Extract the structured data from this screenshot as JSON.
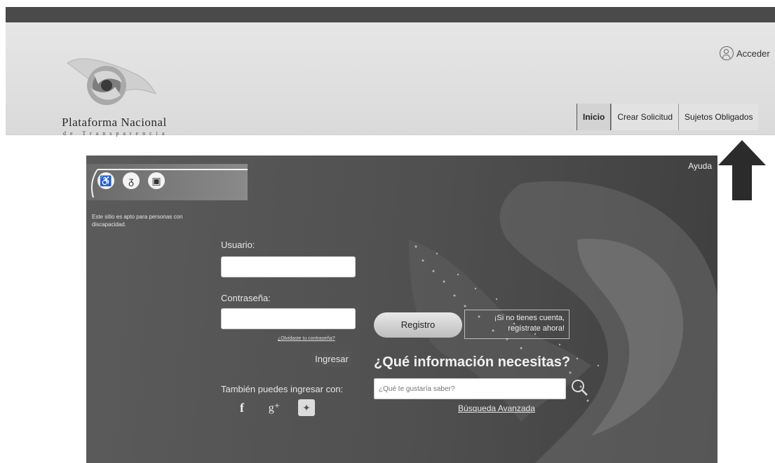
{
  "header": {
    "brand_title": "Plataforma Nacional",
    "brand_subtitle": "de Transparencia",
    "acceder": "Acceder",
    "nav": [
      {
        "label": "Inicio",
        "active": true
      },
      {
        "label": "Crear Solicitud",
        "active": false
      },
      {
        "label": "Sujetos Obligados",
        "active": false
      }
    ]
  },
  "hero": {
    "ayuda": "Ayuda",
    "accessibility_icons": [
      "wheelchair-icon",
      "hearing-icon",
      "image-accessibility-icon"
    ],
    "accessibility_note": "Este sitio es apto para personas con discapacidad.",
    "login": {
      "usuario_label": "Usuario:",
      "password_label": "Contraseña:",
      "forgot": "¿Olvidaste tu contraseña?",
      "ingresar": "Ingresar",
      "social_label": "También puedes ingresar con:",
      "social": [
        "facebook-icon",
        "google-plus-icon",
        "twitter-icon"
      ]
    },
    "registro": {
      "button": "Registro",
      "note_line1": "¡Si no tienes cuenta,",
      "note_line2": "regístrate ahora!"
    },
    "search": {
      "title": "¿Qué información necesitas?",
      "placeholder": "¿Qué te gustaría saber?",
      "advanced": "Búsqueda Avanzada"
    }
  },
  "colors": {
    "hero_background": "#4f4f4f",
    "header_background": "#e2e2e2",
    "arrow": "#2b2b2b"
  }
}
